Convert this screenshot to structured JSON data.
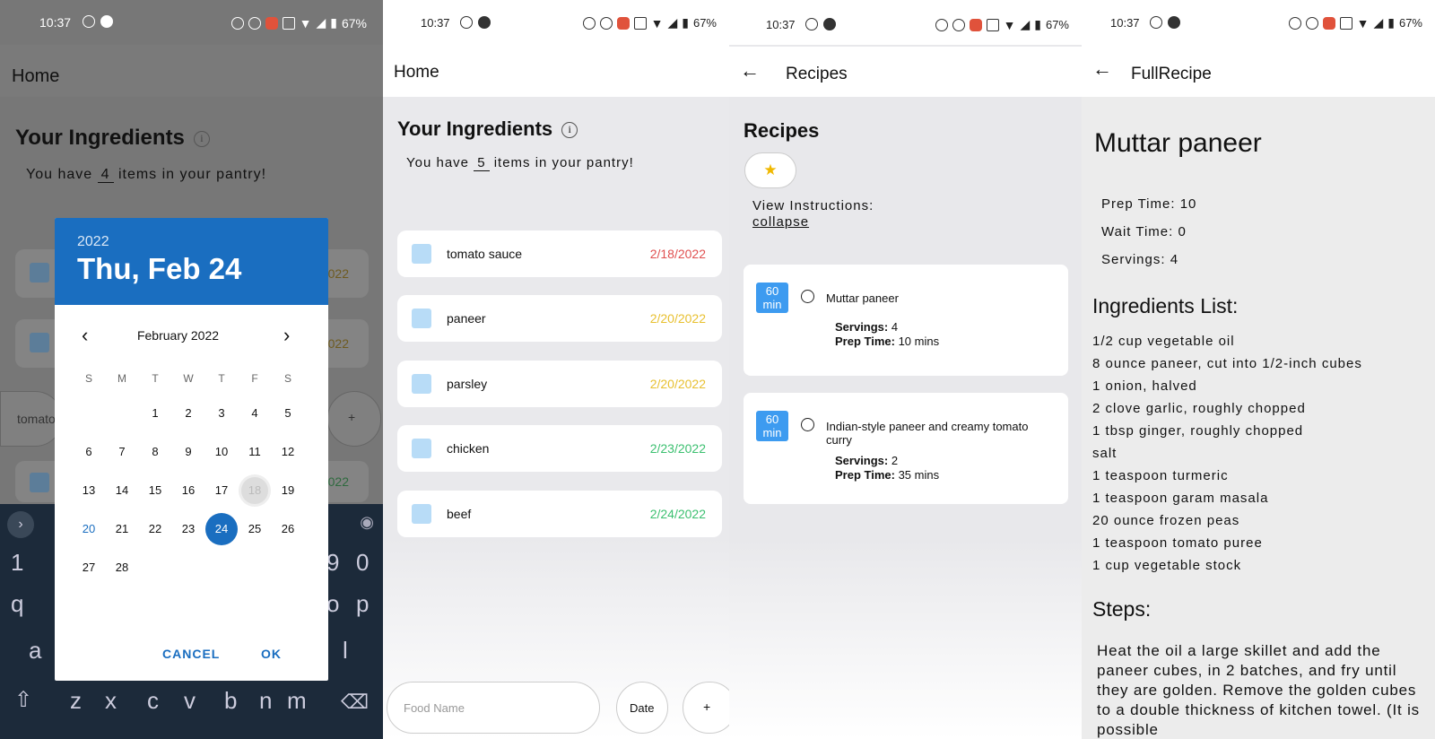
{
  "status_bar": {
    "time": "10:37",
    "battery": "67%"
  },
  "screen1": {
    "app_title": "Home",
    "ingredients_title": "Your Ingredients",
    "count_prefix": "You have",
    "count": "4",
    "count_suffix": "items in your pantry!",
    "input_partial": "tomato",
    "add_label": "+",
    "bg_dates": [
      "022",
      "022",
      "022"
    ],
    "keyboard": {
      "numbers": [
        "1",
        "9",
        "0"
      ],
      "letters_row": [
        "q",
        "o",
        "p"
      ],
      "a_row": [
        "a",
        "l"
      ],
      "bottom_row": [
        "z",
        "x",
        "c",
        "v",
        "b",
        "n",
        "m"
      ]
    },
    "date_picker": {
      "year": "2022",
      "selected_label": "Thu, Feb 24",
      "month_label": "February 2022",
      "weekdays": [
        "S",
        "M",
        "T",
        "W",
        "T",
        "F",
        "S"
      ],
      "weeks": [
        [
          "",
          "",
          "1",
          "2",
          "3",
          "4",
          "5"
        ],
        [
          "6",
          "7",
          "8",
          "9",
          "10",
          "11",
          "12"
        ],
        [
          "13",
          "14",
          "15",
          "16",
          "17",
          "18",
          "19"
        ],
        [
          "20",
          "21",
          "22",
          "23",
          "24",
          "25",
          "26"
        ],
        [
          "27",
          "28",
          "",
          "",
          "",
          "",
          ""
        ]
      ],
      "selected_day": "24",
      "today_day": "20",
      "pressed_day": "18",
      "cancel_label": "CANCEL",
      "ok_label": "OK"
    }
  },
  "screen2": {
    "app_title": "Home",
    "ingredients_title": "Your Ingredients",
    "count_prefix": "You have",
    "count": "5",
    "count_suffix": "items in your pantry!",
    "items": [
      {
        "name": "tomato sauce",
        "date": "2/18/2022",
        "color": "#e05050"
      },
      {
        "name": "paneer",
        "date": "2/20/2022",
        "color": "#e8c030"
      },
      {
        "name": "parsley",
        "date": "2/20/2022",
        "color": "#e8c030"
      },
      {
        "name": "chicken",
        "date": "2/23/2022",
        "color": "#3cc070"
      },
      {
        "name": "beef",
        "date": "2/24/2022",
        "color": "#3cc070"
      }
    ],
    "food_placeholder": "Food Name",
    "date_label": "Date",
    "add_label": "+"
  },
  "screen3": {
    "app_title": "Recipes",
    "heading": "Recipes",
    "view_instructions": "View Instructions:",
    "collapse_label": "collapse",
    "recipes": [
      {
        "time": "60",
        "unit": "min",
        "name": "Muttar paneer",
        "servings_label": "Servings:",
        "servings": "4",
        "prep_label": "Prep Time:",
        "prep": "10 mins"
      },
      {
        "time": "60",
        "unit": "min",
        "name": "Indian-style paneer and creamy tomato curry",
        "servings_label": "Servings:",
        "servings": "2",
        "prep_label": "Prep Time:",
        "prep": "35 mins"
      }
    ]
  },
  "screen4": {
    "app_title": "FullRecipe",
    "recipe_name": "Muttar paneer",
    "prep_time": "Prep Time: 10",
    "wait_time": "Wait Time: 0",
    "servings": "Servings: 4",
    "ingredients_heading": "Ingredients List:",
    "ingredients": [
      "1/2 cup vegetable oil",
      "8 ounce paneer, cut into 1/2-inch cubes",
      "1 onion, halved",
      "2 clove garlic, roughly chopped",
      "1 tbsp ginger, roughly chopped",
      "salt",
      "1 teaspoon turmeric",
      "1 teaspoon garam masala",
      "20 ounce frozen peas",
      "1 teaspoon tomato puree",
      "1 cup vegetable stock"
    ],
    "steps_heading": "Steps:",
    "steps_text": "Heat the oil a large skillet and add the paneer cubes, in 2 batches, and fry until they are golden. Remove the golden cubes to a double thickness of kitchen towel. (It is possible"
  }
}
